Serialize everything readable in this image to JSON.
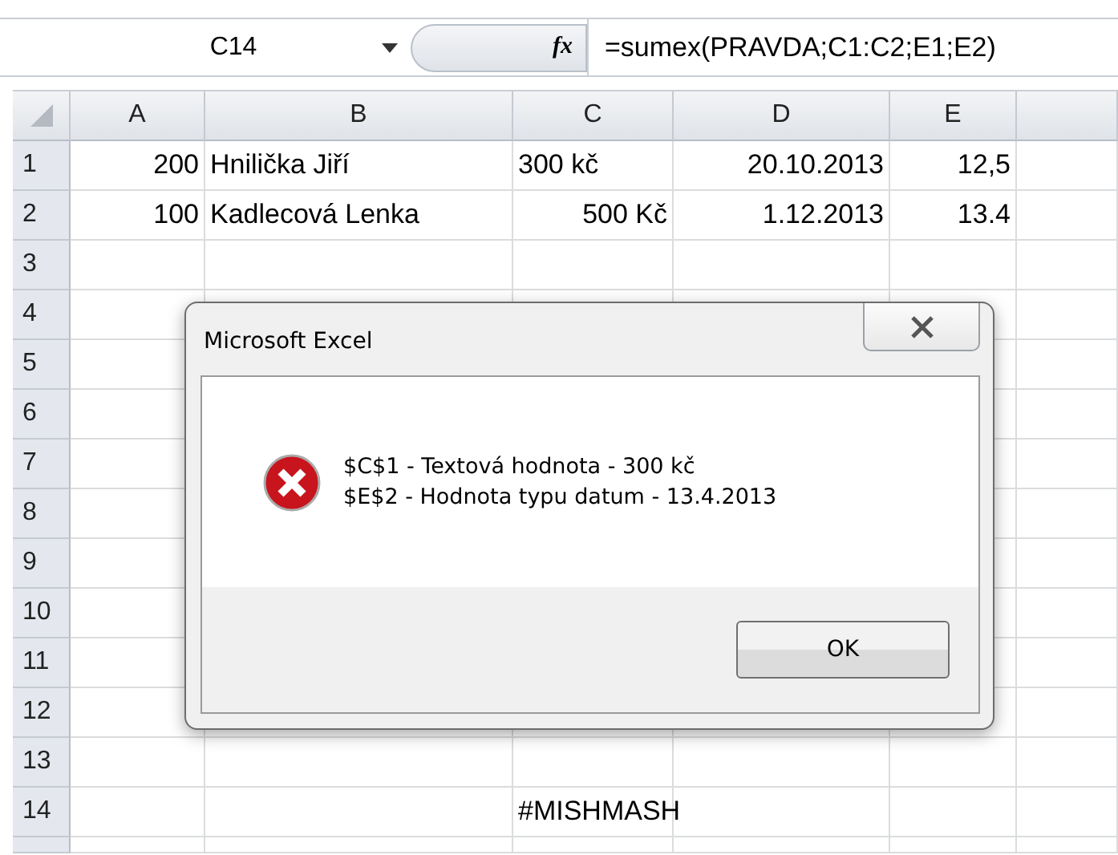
{
  "name_box": "C14",
  "formula_bar": {
    "function_label": "fx",
    "formula": "=sumex(PRAVDA;C1:C2;E1;E2)"
  },
  "columns": [
    "A",
    "B",
    "C",
    "D",
    "E"
  ],
  "rows": [
    {
      "header": "1",
      "cells": [
        {
          "kind": "number",
          "value": "200"
        },
        {
          "kind": "text",
          "value": "Hnilička Jiří"
        },
        {
          "kind": "text",
          "value": "300 kč"
        },
        {
          "kind": "number",
          "value": "20.10.2013"
        },
        {
          "kind": "number",
          "value": "12,5"
        }
      ]
    },
    {
      "header": "2",
      "cells": [
        {
          "kind": "number",
          "value": "100"
        },
        {
          "kind": "text",
          "value": "Kadlecová Lenka"
        },
        {
          "kind": "number",
          "value": "500 Kč"
        },
        {
          "kind": "number",
          "value": "1.12.2013"
        },
        {
          "kind": "number",
          "value": "13.4"
        }
      ]
    },
    {
      "header": "3",
      "cells": []
    },
    {
      "header": "4",
      "cells": []
    },
    {
      "header": "5",
      "cells": []
    },
    {
      "header": "6",
      "cells": []
    },
    {
      "header": "7",
      "cells": []
    },
    {
      "header": "8",
      "cells": []
    },
    {
      "header": "9",
      "cells": []
    },
    {
      "header": "10",
      "cells": []
    },
    {
      "header": "11",
      "cells": []
    },
    {
      "header": "12",
      "cells": []
    },
    {
      "header": "13",
      "cells": []
    },
    {
      "header": "14",
      "cells": [
        {
          "kind": "empty"
        },
        {
          "kind": "empty"
        },
        {
          "kind": "text",
          "value": "#MISHMASH"
        }
      ]
    }
  ],
  "dialog": {
    "title": "Microsoft Excel",
    "messages": [
      "$C$1 - Textová hodnota - 300 kč",
      "$E$2 - Hodnota typu datum - 13.4.2013"
    ],
    "button": "OK"
  }
}
